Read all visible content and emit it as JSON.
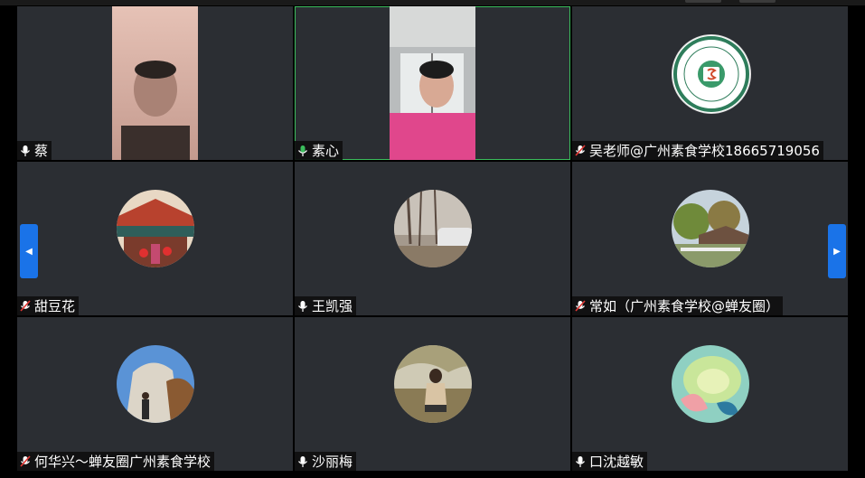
{
  "participants": [
    {
      "name": "蔡",
      "mic": "on"
    },
    {
      "name": "素心",
      "mic": "speaking"
    },
    {
      "name": "吴老师@广州素食学校18665719056",
      "mic": "muted"
    },
    {
      "name": "甜豆花",
      "mic": "muted"
    },
    {
      "name": "王凯强",
      "mic": "on"
    },
    {
      "name": "常如（广州素食学校@蝉友圈）",
      "mic": "muted"
    },
    {
      "name": "何华兴～蝉友圈广州素食学校",
      "mic": "muted"
    },
    {
      "name": "沙丽梅",
      "mic": "on"
    },
    {
      "name": "口沈越敏",
      "mic": "on"
    }
  ],
  "navigation": {
    "prev_glyph": "◀",
    "next_glyph": "▶"
  },
  "colors": {
    "tile_bg": "#2b2e33",
    "active_border": "#3bbd5c",
    "nav_button": "#1a73e8",
    "muted_mic": "#e53935"
  }
}
